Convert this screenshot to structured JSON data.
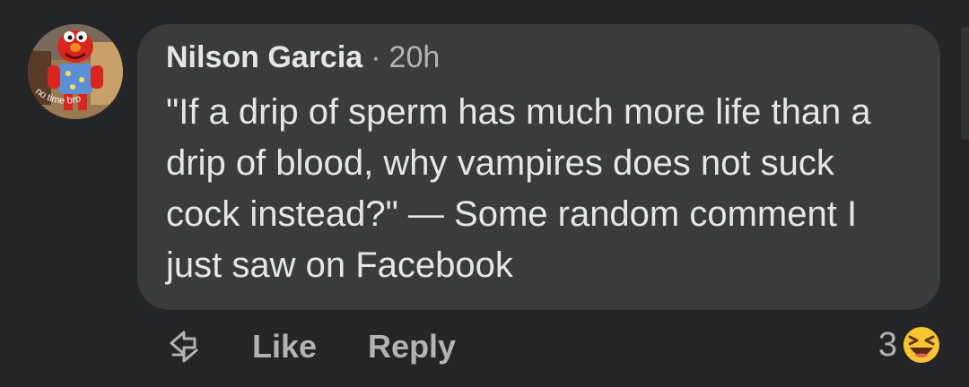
{
  "comment": {
    "author": "Nilson Garcia",
    "separator": "·",
    "time": "20h",
    "text": "\"If a drip of sperm has much more life than a drip of blood, why vampires does not suck cock instead?\" — Some random comment I just saw on Facebook"
  },
  "avatar": {
    "icon": "elmo-avatar",
    "lettering": "no time bro"
  },
  "actions": {
    "share_icon": "share-icon",
    "like_label": "Like",
    "reply_label": "Reply"
  },
  "reactions": {
    "count": "3",
    "icon": "laughing-emoji"
  },
  "colors": {
    "background": "#242526",
    "bubble": "#3a3b3c",
    "primary_text": "#e4e6eb",
    "secondary_text": "#b0b3b8",
    "emoji_yellow": "#f7c533"
  }
}
